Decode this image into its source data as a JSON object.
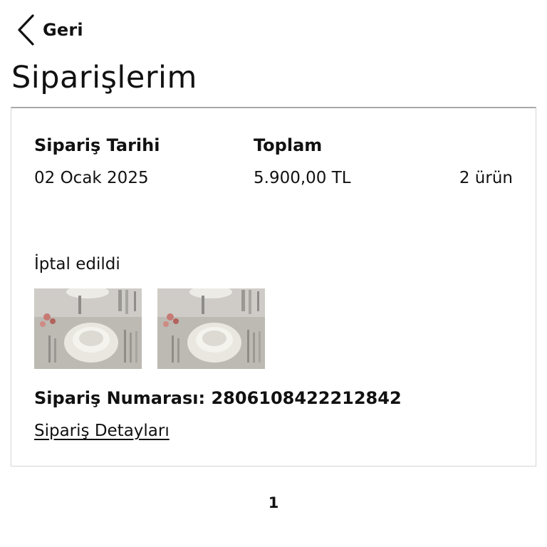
{
  "header": {
    "back_label": "Geri",
    "back_icon": "chevron-left-icon",
    "title": "Siparişlerim"
  },
  "order": {
    "date_label": "Sipariş Tarihi",
    "date_value": "02 Ocak 2025",
    "total_label": "Toplam",
    "total_value": "5.900,00 TL",
    "item_count": "2 ürün",
    "status": "İptal edildi",
    "products": [
      {
        "name": "product-thumbnail-1",
        "image": "tableware-dinner-set"
      },
      {
        "name": "product-thumbnail-2",
        "image": "tableware-dinner-set"
      }
    ],
    "number_label": "Sipariş Numarası:",
    "number_value": "2806108422212842",
    "details_link": "Sipariş Detayları"
  },
  "pagination": {
    "current_page": "1"
  },
  "colors": {
    "text": "#111111",
    "card_border": "#d6d6d6",
    "card_top_border": "#a9a9a9"
  }
}
